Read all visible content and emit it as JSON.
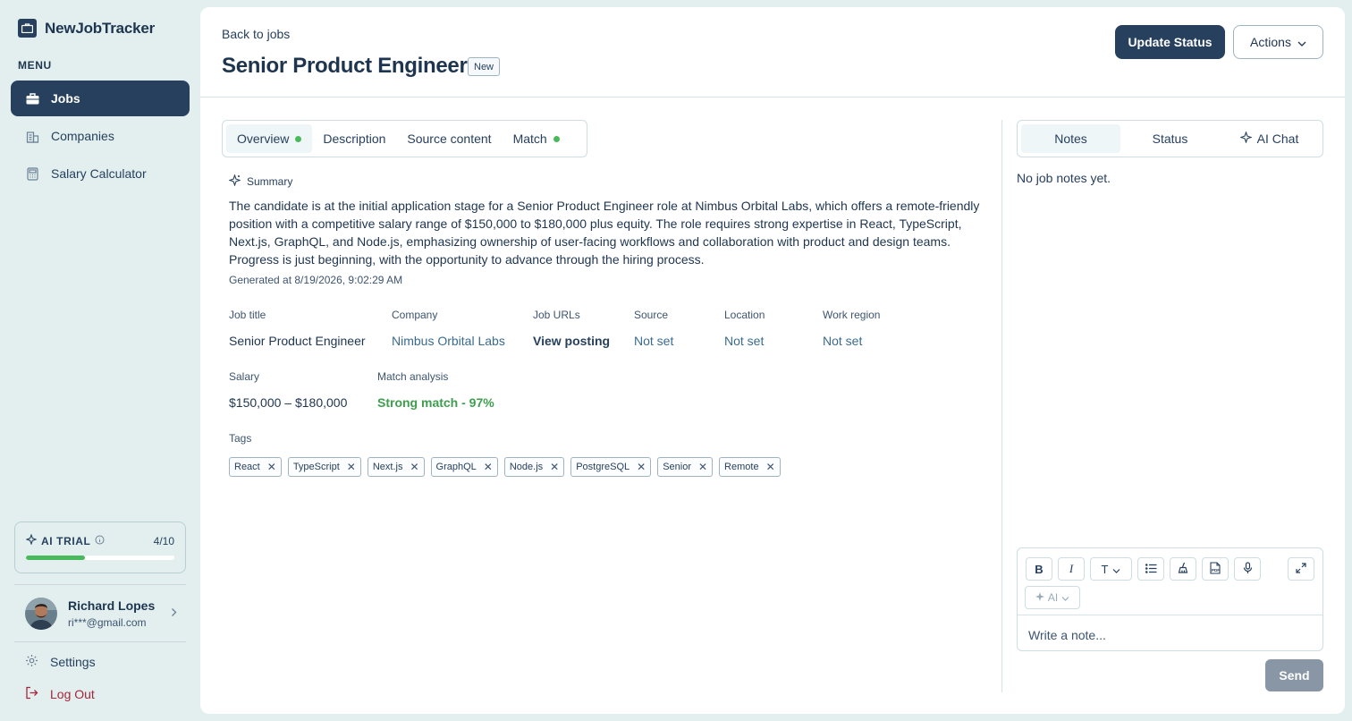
{
  "brand": {
    "name": "NewJobTracker",
    "icon": "briefcase-icon"
  },
  "sidebar": {
    "menu_heading": "MENU",
    "items": [
      {
        "label": "Jobs",
        "icon": "briefcase-icon",
        "active": true
      },
      {
        "label": "Companies",
        "icon": "building-icon",
        "active": false
      },
      {
        "label": "Salary Calculator",
        "icon": "calculator-icon",
        "active": false
      }
    ],
    "trial": {
      "label": "AI TRIAL",
      "count": "4/10",
      "progress": 0.4
    },
    "user": {
      "name": "Richard Lopes",
      "email": "ri***@gmail.com"
    },
    "settings_label": "Settings",
    "logout_label": "Log Out"
  },
  "header": {
    "back_label": "Back to jobs",
    "title": "Senior Product Engineer",
    "badge": "New",
    "update_status_label": "Update Status",
    "actions_label": "Actions"
  },
  "tabs": [
    {
      "label": "Overview",
      "dot": true,
      "active": true
    },
    {
      "label": "Description",
      "dot": false,
      "active": false
    },
    {
      "label": "Source content",
      "dot": false,
      "active": false
    },
    {
      "label": "Match",
      "dot": true,
      "active": false
    }
  ],
  "summary": {
    "heading": "Summary",
    "text": "The candidate is at the initial application stage for a Senior Product Engineer role at Nimbus Orbital Labs, which offers a remote-friendly position with a competitive salary range of $150,000 to $180,000 plus equity. The role requires strong expertise in React, TypeScript, Next.js, GraphQL, and Node.js, emphasizing ownership of user-facing workflows and collaboration with product and design teams. Progress is just beginning, with the opportunity to advance through the hiring process.",
    "generated": "Generated at 8/19/2026, 9:02:29 AM"
  },
  "fields": {
    "job_title": {
      "label": "Job title",
      "value": "Senior Product Engineer"
    },
    "company": {
      "label": "Company",
      "value": "Nimbus Orbital Labs"
    },
    "job_urls": {
      "label": "Job URLs",
      "value": "View posting"
    },
    "source": {
      "label": "Source",
      "value": "Not set"
    },
    "location": {
      "label": "Location",
      "value": "Not set"
    },
    "work_region": {
      "label": "Work region",
      "value": "Not set"
    },
    "salary": {
      "label": "Salary",
      "value": "$150,000 – $180,000"
    },
    "match": {
      "label": "Match analysis",
      "value": "Strong match - 97%"
    }
  },
  "tags": {
    "label": "Tags",
    "items": [
      "React",
      "TypeScript",
      "Next.js",
      "GraphQL",
      "Node.js",
      "PostgreSQL",
      "Senior",
      "Remote"
    ]
  },
  "notes_panel": {
    "tabs": [
      {
        "label": "Notes",
        "active": true
      },
      {
        "label": "Status",
        "active": false
      },
      {
        "label": "AI Chat",
        "active": false,
        "icon": "sparkle-icon"
      }
    ],
    "empty_text": "No job notes yet.",
    "ai_label": "AI",
    "placeholder": "Write a note...",
    "send_label": "Send"
  },
  "colors": {
    "primary": "#27405e",
    "background": "#e2efee",
    "success": "#49ba5b",
    "danger": "#a9243d",
    "send_disabled": "#8996a6"
  }
}
